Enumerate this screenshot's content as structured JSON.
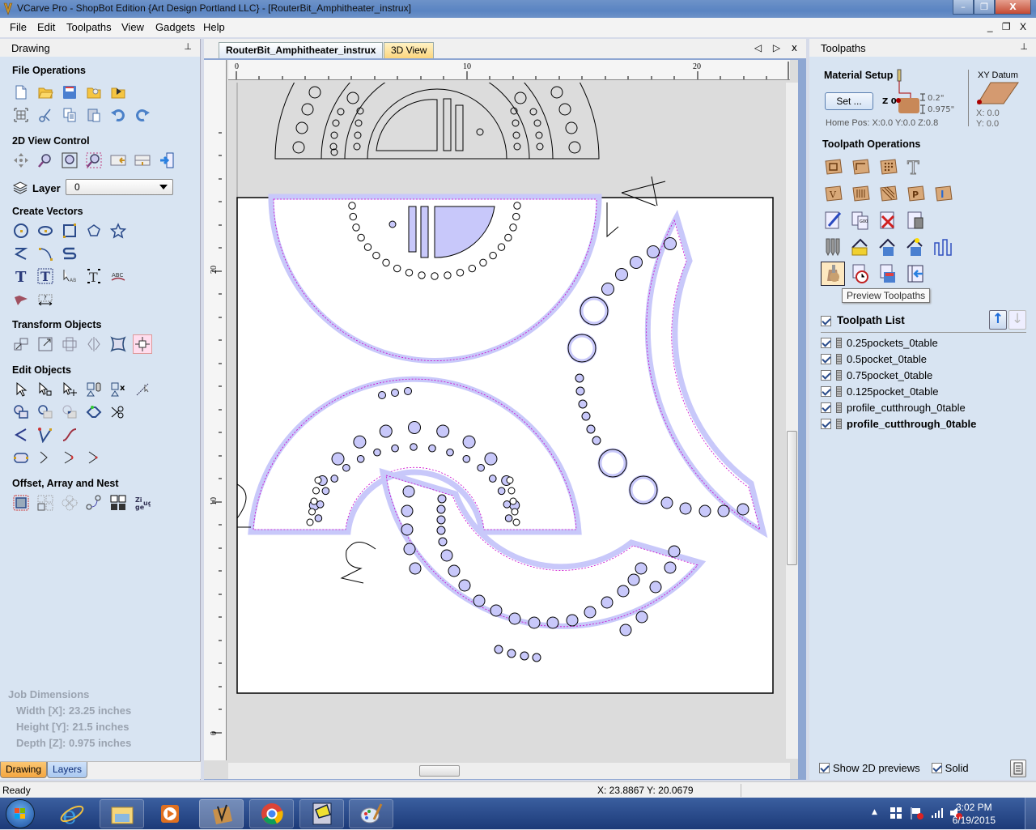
{
  "window": {
    "title": "VCarve Pro - ShopBot Edition {Art Design Portland LLC} - [RouterBit_Amphitheater_instrux]",
    "buttons": {
      "minimize": "–",
      "maximize": "❐",
      "close": "X"
    }
  },
  "menubar": {
    "items": [
      "File",
      "Edit",
      "Toolpaths",
      "View",
      "Gadgets",
      "Help"
    ],
    "mdi_controls": "_ ❐ X"
  },
  "left_panel": {
    "title": "Drawing",
    "pin": "⊥",
    "sections": {
      "file_operations": "File Operations",
      "view_control": "2D View Control",
      "create_vectors": "Create Vectors",
      "transform_objects": "Transform Objects",
      "edit_objects": "Edit Objects",
      "offset_array_nest": "Offset, Array and Nest"
    },
    "layer_label": "Layer",
    "layer_value": "0",
    "job_dimensions": {
      "title": "Job Dimensions",
      "width": "Width  [X]: 23.25 inches",
      "height": "Height [Y]: 21.5 inches",
      "depth": "Depth  [Z]: 0.975 inches"
    },
    "tabs": [
      "Drawing",
      "Layers"
    ]
  },
  "document": {
    "tabs": [
      "RouterBit_Amphitheater_instrux",
      "3D View"
    ],
    "nav": "◁ ▷ x",
    "ruler_h_labels": [
      "0",
      "10",
      "20"
    ],
    "ruler_v_labels": [
      "20",
      "10",
      "0"
    ]
  },
  "right_panel": {
    "title": "Toolpaths",
    "material_setup": {
      "title": "Material Setup",
      "set_button": "Set ...",
      "z0_label": "Z 0",
      "clearance": "0.2\"",
      "thickness": "0.975\"",
      "home_pos": "Home Pos:   X:0.0 Y:0.0 Z:0.8"
    },
    "xy_datum": {
      "title": "XY Datum",
      "x": "X: 0.0",
      "y": "Y: 0.0"
    },
    "toolpath_operations_title": "Toolpath Operations",
    "tooltip": "Preview Toolpaths",
    "toolpath_list": {
      "title": "Toolpath List",
      "items": [
        {
          "name": "0.25pockets_0table",
          "checked": true
        },
        {
          "name": "0.5pocket_0table",
          "checked": true
        },
        {
          "name": "0.75pocket_0table",
          "checked": true
        },
        {
          "name": "0.125pocket_0table",
          "checked": true
        },
        {
          "name": "profile_cutthrough_0table",
          "checked": true
        },
        {
          "name": "profile_cutthrough_0table",
          "checked": true
        }
      ]
    },
    "show_2d_previews": "Show 2D previews",
    "solid": "Solid"
  },
  "statusbar": {
    "status": "Ready",
    "coords": "X: 23.8867 Y: 20.0679"
  },
  "taskbar": {
    "time": "3:02 PM",
    "date": "6/19/2015"
  },
  "colors": {
    "toolpath_fill": "#c8c8fa",
    "toolpath_line": "#cc00cc",
    "panel_bg": "#d8e4f2"
  }
}
